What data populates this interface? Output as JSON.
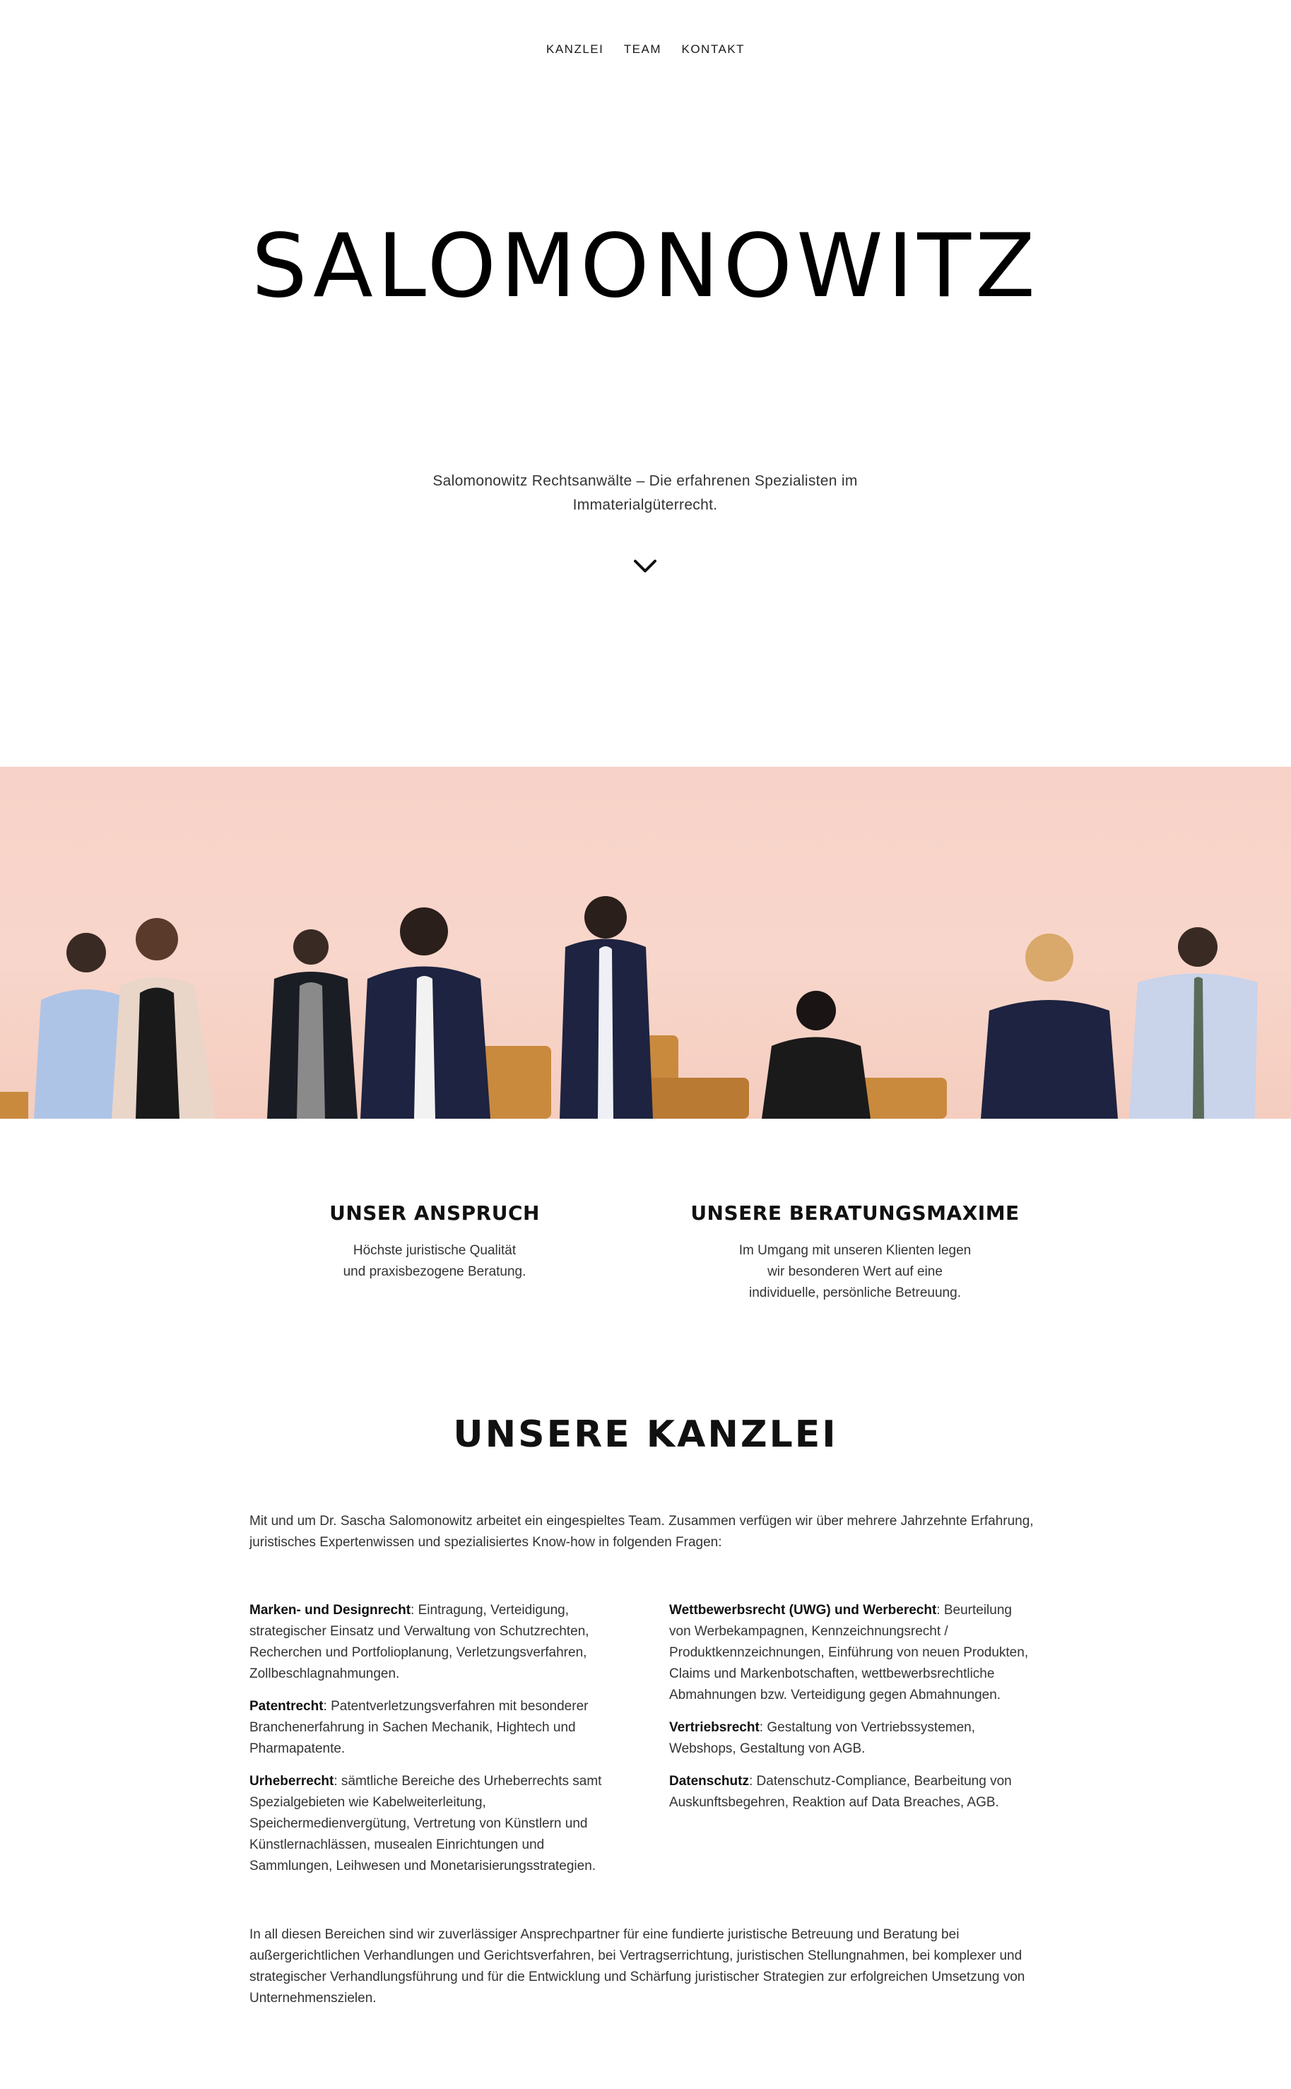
{
  "nav": {
    "items": [
      "KANZLEI",
      "TEAM",
      "KONTAKT"
    ]
  },
  "brand": "SALOMONOWITZ",
  "tagline": "Salomonowitz Rechtsanwälte – Die erfahrenen Spezialisten im Immaterialgüterrecht.",
  "hero": {
    "icon": "team-photo"
  },
  "columns": [
    {
      "title": "UNSER ANSPRUCH",
      "text_line1": "Höchste juristische Qualität",
      "text_line2": "und praxisbezogene Beratung."
    },
    {
      "title": "UNSERE BERATUNGSMAXIME",
      "text_line1": "Im Umgang mit unseren Klienten legen",
      "text_line2": "wir besonderen Wert auf eine",
      "text_line3": "individuelle, persönliche Betreuung."
    }
  ],
  "kanzlei": {
    "title": "UNSERE KANZLEI",
    "intro": "Mit und um Dr. Sascha Salomonowitz arbeitet ein eingespieltes Team. Zusammen verfügen wir über mehrere Jahrzehnte Erfahrung, juristisches Expertenwissen und spezialisiertes Know-how in folgenden Fragen:",
    "areas_left": [
      {
        "name": "Marken- und Designrecht",
        "text": ": Eintragung, Verteidigung, strategischer Einsatz und Verwaltung von Schutzrechten, Recherchen und Portfolioplanung, Verletzungsverfahren, Zollbeschlagnahmungen."
      },
      {
        "name": "Patentrecht",
        "text": ": Patentverletzungsverfahren mit besonderer Branchenerfahrung in Sachen Mechanik, Hightech und Pharmapatente."
      },
      {
        "name": "Urheberrecht",
        "text": ": sämtliche Bereiche des Urheberrechts samt Spezialgebieten wie Kabelweiterleitung, Speichermedienvergütung, Vertretung von Künstlern und Künstlernachlässen, musealen Einrichtungen und Sammlungen, Leihwesen und Monetarisierungsstrategien."
      }
    ],
    "areas_right": [
      {
        "name": "Wettbewerbsrecht (UWG) und Werberecht",
        "text": ": Beurteilung von Werbekampagnen, Kennzeichnungsrecht / Produktkennzeichnungen, Einführung von neuen Produkten, Claims und Markenbotschaften, wettbewerbsrechtliche Abmahnungen bzw. Verteidigung gegen Abmahnungen."
      },
      {
        "name": "Vertriebsrecht",
        "text": ": Gestaltung von Vertriebssystemen, Webshops, Gestaltung von AGB."
      },
      {
        "name": "Datenschutz",
        "text": ": Datenschutz-Compliance, Bearbeitung von Auskunftsbegehren, Reaktion auf Data Breaches, AGB."
      }
    ],
    "outro": "In all diesen Bereichen sind wir zuverlässiger Ansprechpartner für eine fundierte juristische Betreuung und Beratung bei außergerichtlichen Verhandlungen und Gerichtsverfahren, bei Vertragserrichtung, juristischen Stellungnahmen, bei komplexer und strategischer Verhandlungsführung und für die Entwicklung und Schärfung juristischer Strategien zur erfolgreichen Umsetzung von Unternehmenszielen."
  },
  "colors": {
    "text": "#333333",
    "heading": "#111111",
    "hero_bg": "#f7d2c8"
  }
}
